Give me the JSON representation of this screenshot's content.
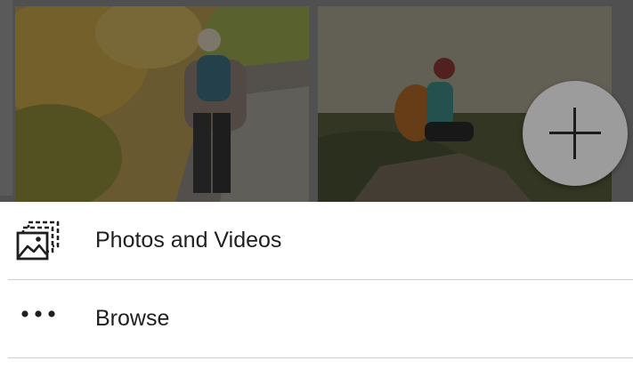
{
  "sheet": {
    "items": [
      {
        "label": "Photos and Videos",
        "icon": "photos-videos-icon"
      },
      {
        "label": "Browse",
        "icon": "more-dots-icon"
      }
    ]
  },
  "fab": {
    "icon": "plus-icon"
  },
  "colors": {
    "sheet_background": "#ffffff",
    "label_text": "#1f1f1f",
    "divider": "#cfcfcf",
    "fab": "#9c9c9c",
    "scrim": "rgba(0,0,0,0.42)"
  }
}
